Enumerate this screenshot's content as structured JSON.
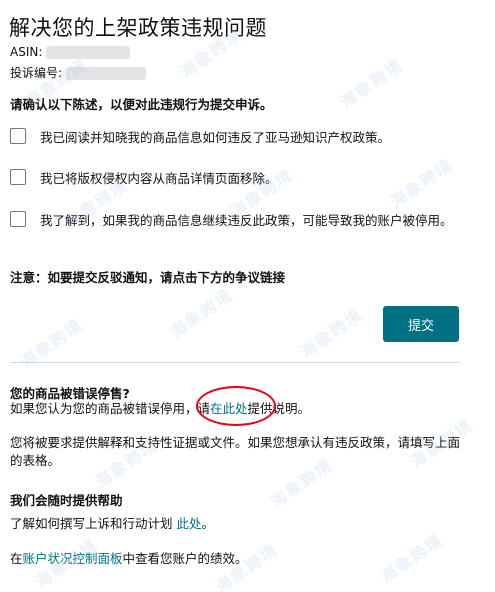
{
  "header": {
    "title": "解决您的上架政策违规问题",
    "asin_label": "ASIN:",
    "case_label": "投诉编号:"
  },
  "form": {
    "prompt": "请确认以下陈述，以便对此违规行为提交申诉。",
    "acknowledgements": [
      {
        "label": "我已阅读并知晓我的商品信息如何违反了亚马逊知识产权政策。",
        "checked": false
      },
      {
        "label": "我已将版权侵权内容从商品详情页面移除。",
        "checked": false
      },
      {
        "label": "我了解到，如果我的商品信息继续违反此政策，可能导致我的账户被停用。",
        "checked": false
      }
    ],
    "notice": "注意：如要提交反驳通知，请点击下方的争议链接",
    "submit_label": "提交"
  },
  "appeal": {
    "title": "您的商品被错误停售?",
    "text_before": "如果您认为您的商品被错误停用，请",
    "link": "在此处",
    "text_after": "提供说明。",
    "evidence_text": "您将被要求提供解释和支持性证据或文件。如果您想承认有违反政策，请填写上面的表格。"
  },
  "help": {
    "title": "我们会随时提供帮助",
    "text_before": "了解如何撰写上诉和行动计划 ",
    "link": "此处",
    "text_after": "。",
    "dashboard_before": "在",
    "dashboard_link": "账户状况控制面板",
    "dashboard_after": "中查看您账户的绩效。"
  },
  "watermark": {
    "text": "海象跨境"
  },
  "colors": {
    "accent": "#007185",
    "button_bg": "#007185",
    "annotation": "#e60012",
    "divider": "#d5d9d9",
    "text": "#111111"
  },
  "icons": {
    "checkbox": "checkbox-empty-icon"
  }
}
